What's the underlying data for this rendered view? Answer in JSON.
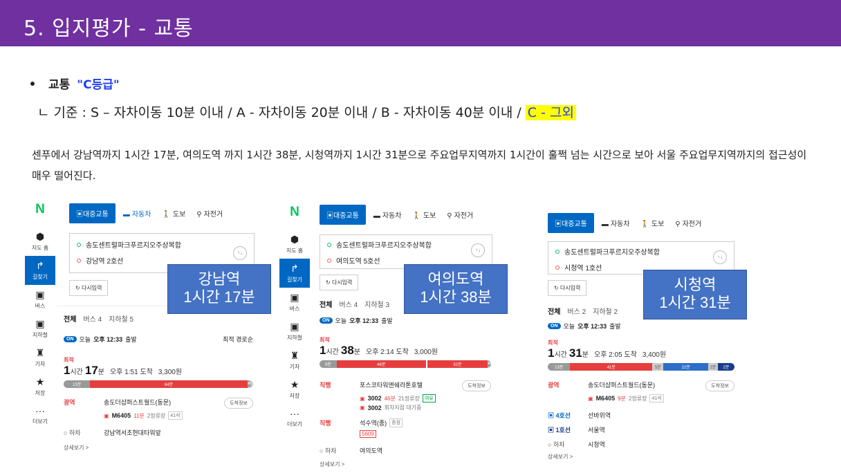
{
  "slide": {
    "title": "5. 입지평가 - 교통",
    "bullet_label": "교통",
    "bullet_grade": "\"C등급\"",
    "criteria_prefix": "ㄴ 기준 : S – 자차이동 10분 이내 / A - 자차이동 20분 이내 / B - 자차이동 40분 이내  / ",
    "criteria_highlight": "C - 그외",
    "description": "센푸에서 강남역까지 1시간 17분, 여의도역 까지 1시간 38분, 시청역까지 1시간 31분으로 주요업무지역까지 1시간이 훌쩍 넘는 시간으로 보아 서울 주요업무지역까지의 접근성이 매우 떨어진다."
  },
  "side_nav": {
    "logo": "N",
    "items": [
      {
        "icon": "location-pin-icon",
        "glyph": "⬢",
        "label": "지도 홈"
      },
      {
        "icon": "directions-icon",
        "glyph": "↱",
        "label": "길찾기"
      },
      {
        "icon": "bus-icon",
        "glyph": "▣",
        "label": "버스"
      },
      {
        "icon": "subway-icon",
        "glyph": "▣",
        "label": "지하철"
      },
      {
        "icon": "train-icon",
        "glyph": "♜",
        "label": "기차"
      },
      {
        "icon": "star-icon",
        "glyph": "★",
        "label": "저장"
      },
      {
        "icon": "more-icon",
        "glyph": "···",
        "label": "더보기"
      }
    ]
  },
  "modes": {
    "transit": "대중교통",
    "car": "자동차",
    "walk": "도보",
    "bike": "자전거"
  },
  "origin": "송도센트럴파크푸르지오주상복합",
  "retry": "다시입력",
  "depart_today": "오늘",
  "depart_time": "오후 12:33",
  "depart_suffix": "출발",
  "on_badge": "ON",
  "best_label": "최적",
  "more_label": "상세보기 >",
  "info_label": "도착정보",
  "alight": "하차",
  "panels": [
    {
      "dest": "강남역 2호선",
      "tabs": [
        "전체",
        "버스 4",
        "지하철 5"
      ],
      "sort": "최적 경로순",
      "hours": "1",
      "hours_unit": "시간",
      "minutes": "17",
      "minutes_unit": "분",
      "arrive": "오후 1:51 도착",
      "fare": "3,300원",
      "bar": [
        "13분",
        "64분",
        "1분"
      ],
      "leg1_tag": "광역",
      "leg1_stop": "송도더샵퍼스트월드(동문)",
      "leg1_bus": "M6405",
      "leg1_late": "11분",
      "leg1_note": "2정류장",
      "leg1_seat": "41석",
      "alight_stop": "강남역서초현대타워앞",
      "overlay_name": "강남역",
      "overlay_time": "1시간 17분"
    },
    {
      "dest": "여의도역 5호선",
      "tabs": [
        "전체",
        "버스 4",
        "지하철 3"
      ],
      "hours": "1",
      "hours_unit": "시간",
      "minutes": "38",
      "minutes_unit": "분",
      "arrive": "오후 2:14 도착",
      "fare": "3,000원",
      "bar": [
        "9분",
        "46분",
        "32분",
        "1분"
      ],
      "leg1_tag": "직행",
      "leg1_stop": "포스코타워앤쉐라톤호텔",
      "leg1_bus": "3002",
      "leg1_late": "46분",
      "leg1_note": "21정류장",
      "leg1_seat": "여유",
      "leg1_bus2": "3002",
      "leg1_note2": "회차지점 대기중",
      "leg2_tag": "직행",
      "leg2_stop": "석수역(종)",
      "leg2_seat": "종점",
      "leg2_bus": "5609",
      "alight_stop": "여의도역",
      "overlay_name": "여의도역",
      "overlay_time": "1시간 38분"
    },
    {
      "dest": "시청역 1호선",
      "tabs": [
        "전체",
        "버스 2",
        "지하철 2"
      ],
      "hours": "1",
      "hours_unit": "시간",
      "minutes": "31",
      "minutes_unit": "분",
      "arrive": "오후 2:05 도착",
      "fare": "3,400원",
      "bar": [
        "13분",
        "41분",
        "5분",
        "22분",
        "2분",
        "2분"
      ],
      "leg1_tag": "광역",
      "leg1_stop": "송도더샵퍼스트월드(동문)",
      "leg1_bus": "M6405",
      "leg1_late": "9분",
      "leg1_note": "2정류장",
      "leg1_seat": "41석",
      "leg2_tag": "4호선",
      "leg2_stop": "선바위역",
      "leg3_tag": "1호선",
      "leg3_stop": "서울역",
      "alight_stop": "시청역",
      "overlay_name": "시청역",
      "overlay_time": "1시간 31분"
    }
  ]
}
